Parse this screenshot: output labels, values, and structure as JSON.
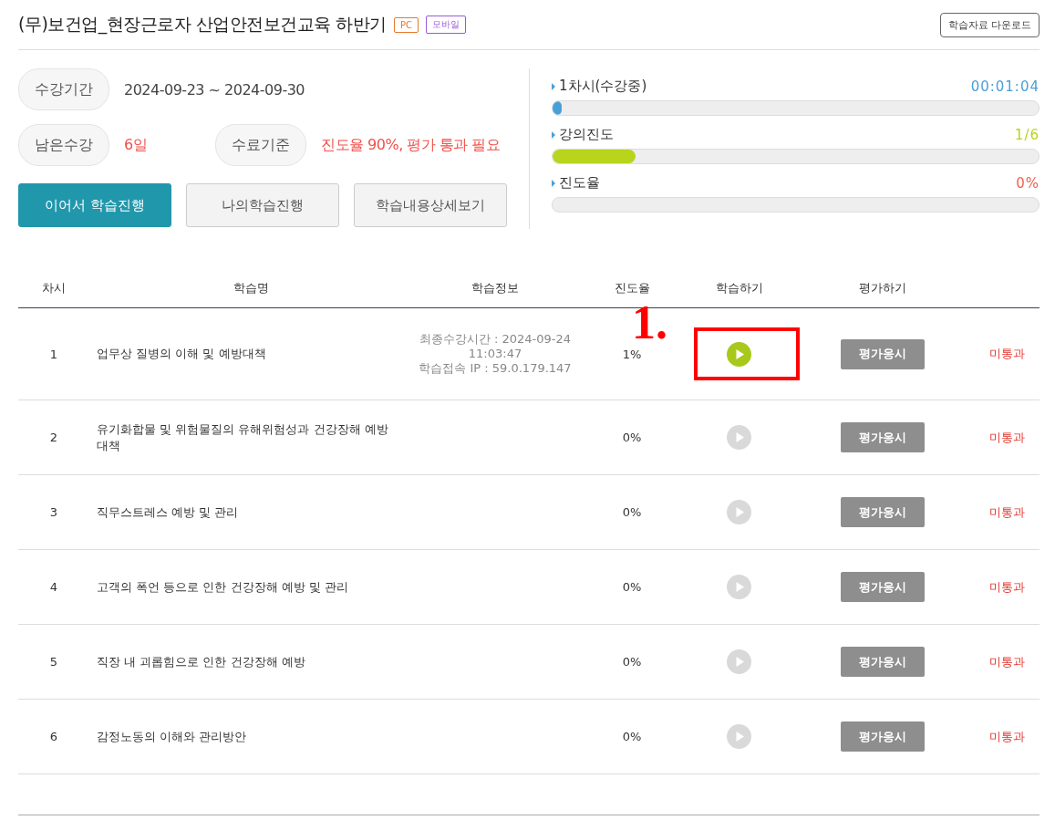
{
  "header": {
    "title": "(무)보건업_현장근로자 산업안전보건교육 하반기",
    "badges": [
      {
        "label": "PC",
        "color": "#e8782c"
      },
      {
        "label": "모바일",
        "color": "#9b59d6"
      }
    ],
    "download_button": "학습자료 다운로드"
  },
  "info": [
    {
      "label": "수강기간",
      "value": "2024-09-23 ~ 2024-09-30",
      "kind": "plain"
    },
    {
      "label": "남은수강",
      "value": "6일",
      "kind": "alert"
    },
    {
      "label": "수료기준",
      "value": "진도율 90%, 평가 통과 필요",
      "kind": "alert"
    }
  ],
  "actions": [
    {
      "label": "이어서 학습진행",
      "primary": true
    },
    {
      "label": "나의학습진행",
      "primary": false
    },
    {
      "label": "학습내용상세보기",
      "primary": false
    }
  ],
  "meters": [
    {
      "label": "1차시(수강중)",
      "reading": "00:01:04",
      "level": 0.01,
      "color": "#4aa0d5"
    },
    {
      "label": "강의진도",
      "reading": "1/6",
      "level": 0.17,
      "color": "#b8d41c"
    },
    {
      "label": "진도율",
      "reading": "0%",
      "level": 0,
      "color": "#f0604a"
    }
  ],
  "table": {
    "columns": [
      "차시",
      "학습명",
      "학습정보",
      "진도율",
      "학습하기",
      "평가하기"
    ],
    "rows": [
      {
        "no": "1",
        "title": "업무상 질병의 이해 및 예방대책",
        "info": [
          "최종수강시간 : 2024-09-24",
          "11:03:47",
          "학습접속 IP : 59.0.179.147"
        ],
        "progress": "1%",
        "active": true,
        "exam": "평가응시",
        "result": "미통과"
      },
      {
        "no": "2",
        "title": "유기화합물 및 위험물질의 유해위험성과 건강장해 예방대책",
        "info": [],
        "progress": "0%",
        "active": false,
        "exam": "평가응시",
        "result": "미통과"
      },
      {
        "no": "3",
        "title": "직무스트레스 예방 및 관리",
        "info": [],
        "progress": "0%",
        "active": false,
        "exam": "평가응시",
        "result": "미통과"
      },
      {
        "no": "4",
        "title": "고객의 폭언 등으로 인한 건강장해 예방 및 관리",
        "info": [],
        "progress": "0%",
        "active": false,
        "exam": "평가응시",
        "result": "미통과"
      },
      {
        "no": "5",
        "title": "직장 내 괴롭힘으로 인한 건강장해 예방",
        "info": [],
        "progress": "0%",
        "active": false,
        "exam": "평가응시",
        "result": "미통과"
      },
      {
        "no": "6",
        "title": "감정노동의 이해와 관리방안",
        "info": [],
        "progress": "0%",
        "active": false,
        "exam": "평가응시",
        "result": "미통과"
      }
    ]
  },
  "annotation": {
    "label": "1."
  }
}
